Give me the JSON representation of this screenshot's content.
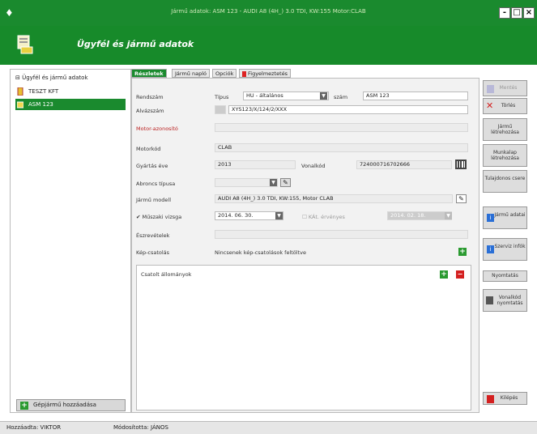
{
  "window": {
    "title": "Jármű adatok: ASM 123 - AUDI A8 (4H_) 3.0 TDI, KW:155 Motor:CLAB",
    "minimize": "-",
    "maximize": "□",
    "close": "×"
  },
  "header": {
    "title": "Ügyfél és jármű adatok"
  },
  "tree": {
    "root": "Ügyfél és jármű adatok",
    "items": [
      {
        "label": "TESZT KFT",
        "selected": false
      },
      {
        "label": "ASM 123",
        "selected": true
      }
    ],
    "add_vehicle": "Gépjármű hozzáadása"
  },
  "tabs": [
    {
      "label": "Részletek",
      "active": true
    },
    {
      "label": "Jármű napló",
      "active": false
    },
    {
      "label": "Opciók",
      "active": false
    },
    {
      "label": "Figyelmeztetés",
      "active": false,
      "alert": true
    }
  ],
  "form": {
    "rendszam_label": "Rendszám",
    "tipus_label": "Típus",
    "tipus_value": "HU - általános",
    "szam_label": "szám",
    "szam_value": "ASM 123",
    "alvazszam_label": "Alvázszám",
    "alvazszam_value": "XYS123/X/124/2/XXX",
    "motor_azon_label": "Motor-azonosító",
    "motor_azon_value": "",
    "motorkod_label": "Motorkód",
    "motorkod_value": "CLAB",
    "gyartas_label": "Gyártás éve",
    "gyartas_value": "2013",
    "vonalkod_label": "Vonalkód",
    "vonalkod_value": "7240007167026​66",
    "abroncs_label": "Abroncs típusa",
    "abroncs_value": "",
    "jarmu_modell_label": "Jármű modell",
    "jarmu_modell_value": "AUDI A8 (4H_) 3.0 TDI, KW:155, Motor CLAB",
    "muszaki_label": "Műszaki vizsga",
    "muszaki_checked": true,
    "muszaki_value": "2014. 06. 30.",
    "kgk_label": "KÁt. érvényes",
    "kgk_value": "2014. 02. 18.",
    "egyeb_label": "Észrevételek",
    "egyeb_value": "",
    "kepmelle_label": "Kép-csatolás",
    "kepmelle_value": "Nincsenek kép-csatolások feltöltve",
    "csatolt_label": "Csatolt állományok"
  },
  "right_buttons": [
    {
      "label": "Mentés",
      "icon": "save-icon",
      "disabled": true
    },
    {
      "label": "Törlés",
      "icon": "delete-icon"
    },
    {
      "label": "Jármű létrehozása",
      "icon": ""
    },
    {
      "label": "Munkalap létrehozása",
      "icon": ""
    },
    {
      "label": "Tulajdonos csere",
      "icon": ""
    },
    {
      "label": "Jármű adatai",
      "icon": "info-icon"
    },
    {
      "label": "Szerviz infók",
      "icon": "info-icon"
    },
    {
      "label": "Nyomtatás",
      "icon": ""
    },
    {
      "label": "Vonalkód nyomtatás",
      "icon": "barcode-icon"
    },
    {
      "label": "Kilépés",
      "icon": "exit-icon"
    }
  ],
  "status": {
    "created_by": "Hozzáadta: VIKTOR",
    "modified_by": "Módosította: JÁNOS"
  },
  "colors": {
    "accent": "#1a8a2e",
    "danger": "#d42020"
  }
}
